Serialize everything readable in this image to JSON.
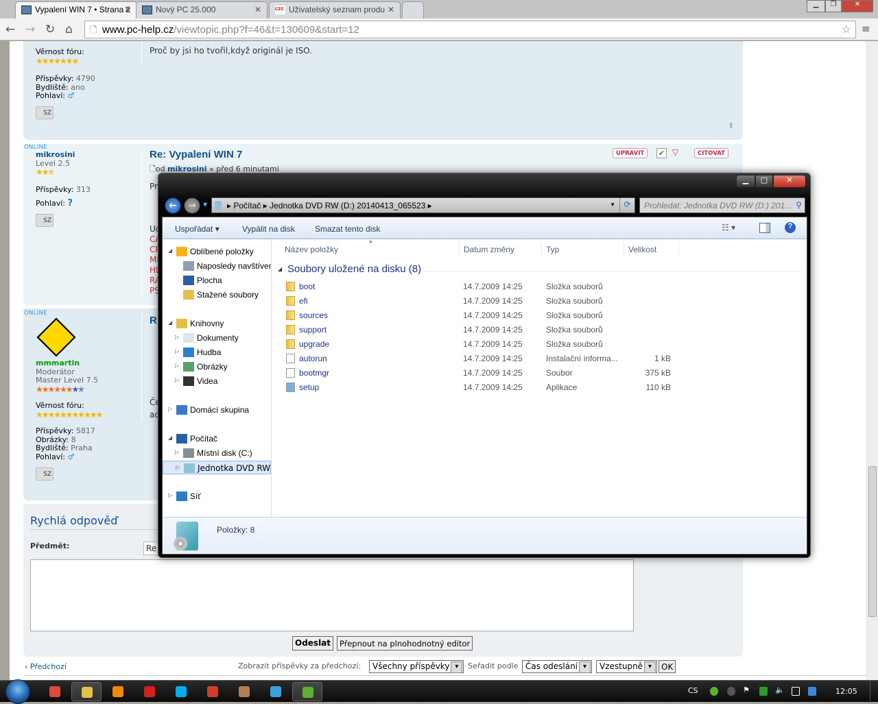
{
  "browser": {
    "tabs": [
      {
        "label": "Vypalení WIN 7 • Strana 2"
      },
      {
        "label": "Nový PC 25.000"
      },
      {
        "label": "Uživatelský seznam produ"
      }
    ],
    "url_host": "www.pc-help.cz",
    "url_path": "/viewtopic.php?f=46&t=130609&start=12"
  },
  "posts": [
    {
      "loyalty_label": "Věrnost fóru:",
      "posts_label": "Příspěvky:",
      "posts": "4790",
      "loc_label": "Bydliště:",
      "loc": "ano",
      "gender_label": "Pohlaví:",
      "gender": "♂",
      "pm": "SZ",
      "text": "Proč by jsi ho tvořil,když originál je ISO."
    },
    {
      "online": "ONLINE",
      "user": "mikrosini",
      "rank": "Level 2.5",
      "posts_label": "Příspěvky:",
      "posts": "313",
      "gender_label": "Pohlaví:",
      "gender": "?",
      "pm": "SZ",
      "title": "Re: Vypalení WIN 7",
      "by_prefix": "od",
      "by_user": "mikrosini",
      "by_suffix": "» před 6 minutami",
      "text_start": "Pr",
      "lines": [
        "Ud",
        "CA",
        "CP",
        "MB",
        "HD",
        "RA",
        "PS"
      ],
      "buttons": {
        "edit": "UPRAVIT",
        "quote": "CITOVAT"
      }
    },
    {
      "online": "ONLINE",
      "user": "mmmartin",
      "role": "Moderátor",
      "rank": "Master Level 7.5",
      "loyalty_label": "Věrnost fóru:",
      "posts_label": "Příspěvky:",
      "posts": "5817",
      "img_label": "Obrázky:",
      "img": "8",
      "loc_label": "Bydliště:",
      "loc": "Praha",
      "gender_label": "Pohlaví:",
      "gender": "♂",
      "pm": "SZ",
      "title_start": "R",
      "lines": [
        "Če",
        "ad"
      ]
    }
  ],
  "quick_reply": {
    "title": "Rychlá odpověď",
    "subject_label": "Předmět:",
    "subject_value": "Re",
    "send": "Odeslat",
    "full_editor": "Přepnout na plnohodnotný editor"
  },
  "footer": {
    "prev": "Předchozí",
    "show_label": "Zobrazit příspěvky za předchozí:",
    "show_value": "Všechny příspěvky",
    "sort_label": "Seřadit podle",
    "sort_value": "Čas odeslání",
    "order_value": "Vzestupně",
    "ok": "OK"
  },
  "explorer": {
    "breadcrumb": [
      "Počítač",
      "Jednotka DVD RW (D:) 20140413_065523"
    ],
    "search_placeholder": "Prohledat: Jednotka DVD RW (D:) 201...",
    "commands": [
      "Uspořádat ▾",
      "Vypálit na disk",
      "Smazat tento disk"
    ],
    "nav": [
      {
        "label": "Oblíbené položky",
        "level": 0,
        "arrow": "◢",
        "icon": "star-icon",
        "color": "#f3b31b"
      },
      {
        "label": "Naposledy navštívené",
        "level": 1,
        "icon": "recent-places-icon",
        "color": "#8aa0b8"
      },
      {
        "label": "Plocha",
        "level": 1,
        "icon": "desktop-icon",
        "color": "#2b5fa8"
      },
      {
        "label": "Stažené soubory",
        "level": 1,
        "icon": "downloads-icon",
        "color": "#e2c04a"
      },
      {
        "label": "Knihovny",
        "level": 0,
        "arrow": "◢",
        "icon": "libraries-icon",
        "color": "#e2c04a",
        "gap": true
      },
      {
        "label": "Dokumenty",
        "level": 1,
        "arrow": "▷",
        "icon": "documents-icon",
        "color": "#dfe6ee"
      },
      {
        "label": "Hudba",
        "level": 1,
        "arrow": "▷",
        "icon": "music-icon",
        "color": "#2a7fd0"
      },
      {
        "label": "Obrázky",
        "level": 1,
        "arrow": "▷",
        "icon": "pictures-icon",
        "color": "#5c9f6a"
      },
      {
        "label": "Videa",
        "level": 1,
        "arrow": "▷",
        "icon": "videos-icon",
        "color": "#333"
      },
      {
        "label": "Domácí skupina",
        "level": 0,
        "arrow": "▷",
        "icon": "homegroup-icon",
        "color": "#3a7ac8",
        "gap": true
      },
      {
        "label": "Počítač",
        "level": 0,
        "arrow": "◢",
        "icon": "computer-icon",
        "color": "#2b5fa8",
        "gap": true
      },
      {
        "label": "Místní disk  (C:)",
        "level": 1,
        "arrow": "▷",
        "icon": "local-disk-icon",
        "color": "#8a8f96"
      },
      {
        "label": "Jednotka DVD RW (D:)",
        "level": 1,
        "arrow": "▷",
        "icon": "dvd-drive-icon",
        "color": "#8fc3d8",
        "selected": true
      },
      {
        "label": "Síť",
        "level": 0,
        "arrow": "▷",
        "icon": "network-icon",
        "color": "#2b7fc8",
        "gap": true
      }
    ],
    "columns": [
      "Název položky",
      "Datum změny",
      "Typ",
      "Velikost"
    ],
    "group_title": "Soubory uložené na disku (8)",
    "files": [
      {
        "name": "boot",
        "date": "14.7.2009 14:25",
        "type": "Složka souborů",
        "size": "",
        "icon": "folder-icon"
      },
      {
        "name": "efi",
        "date": "14.7.2009 14:25",
        "type": "Složka souborů",
        "size": "",
        "icon": "folder-icon"
      },
      {
        "name": "sources",
        "date": "14.7.2009 14:25",
        "type": "Složka souborů",
        "size": "",
        "icon": "folder-icon"
      },
      {
        "name": "support",
        "date": "14.7.2009 14:25",
        "type": "Složka souborů",
        "size": "",
        "icon": "folder-icon"
      },
      {
        "name": "upgrade",
        "date": "14.7.2009 14:25",
        "type": "Složka souborů",
        "size": "",
        "icon": "folder-icon"
      },
      {
        "name": "autorun",
        "date": "14.7.2009 14:25",
        "type": "Instalační informa...",
        "size": "1 kB",
        "icon": "setup-info-icon"
      },
      {
        "name": "bootmgr",
        "date": "14.7.2009 14:25",
        "type": "Soubor",
        "size": "375 kB",
        "icon": "file-icon"
      },
      {
        "name": "setup",
        "date": "14.7.2009 14:25",
        "type": "Aplikace",
        "size": "110 kB",
        "icon": "application-icon"
      }
    ],
    "status": "Položky: 8"
  },
  "taskbar": {
    "lang": "CS",
    "clock": "12:05",
    "apps": [
      {
        "icon": "chrome-icon",
        "color": "#dd4b39"
      },
      {
        "icon": "explorer-icon",
        "color": "#e2c04a",
        "active": true
      },
      {
        "icon": "media-player-icon",
        "color": "#f08a00"
      },
      {
        "icon": "h-app-icon",
        "color": "#d42020"
      },
      {
        "icon": "skype-icon",
        "color": "#00aff0"
      },
      {
        "icon": "ccleaner-icon",
        "color": "#d43b2a"
      },
      {
        "icon": "app-icon",
        "color": "#b08050"
      },
      {
        "icon": "shield-app-icon",
        "color": "#3aa0e0"
      },
      {
        "icon": "utorrent-icon",
        "color": "#5bb030",
        "active": true
      }
    ]
  }
}
